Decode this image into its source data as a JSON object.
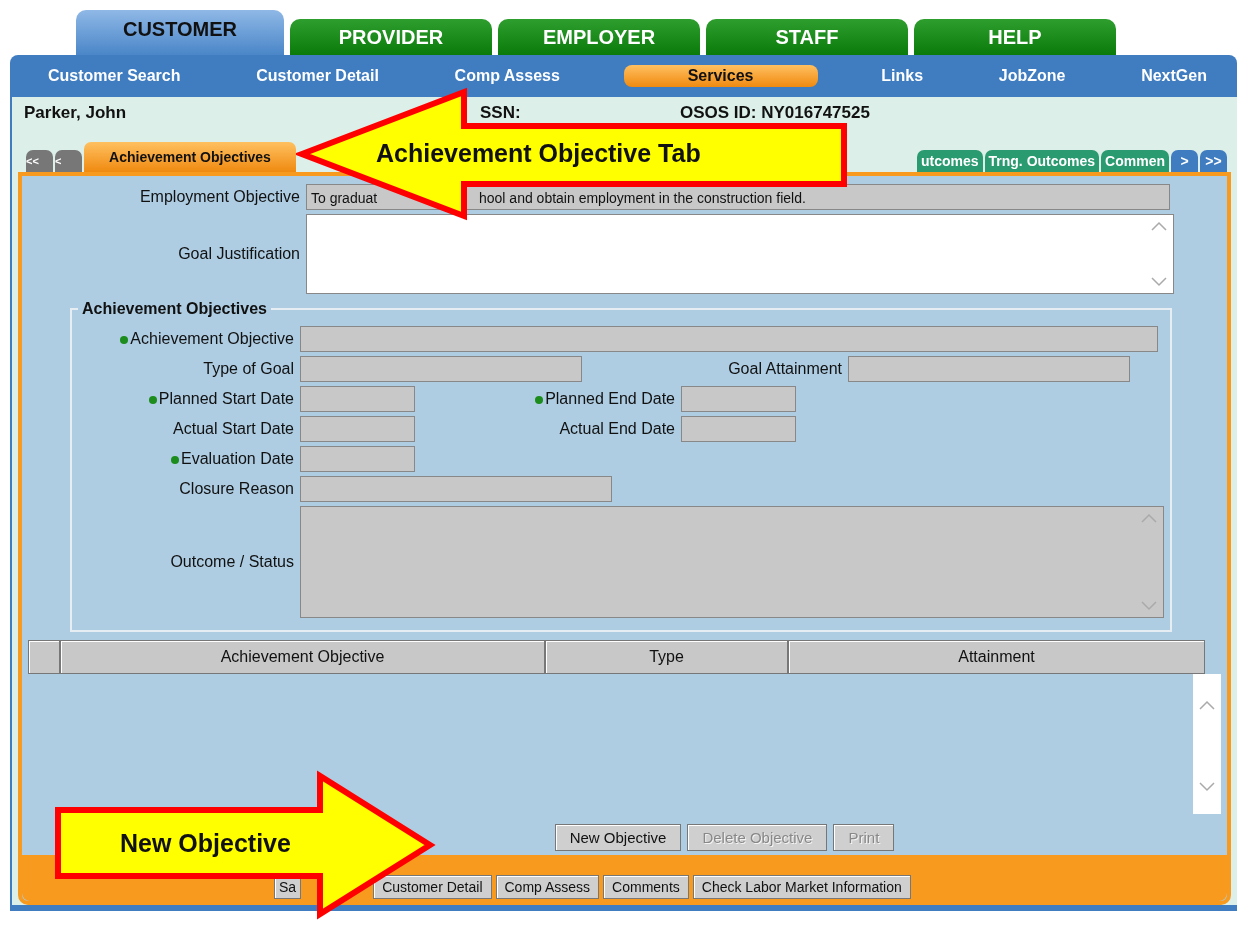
{
  "top_tabs": [
    {
      "label": "CUSTOMER",
      "selected": true
    },
    {
      "label": "PROVIDER",
      "selected": false
    },
    {
      "label": "EMPLOYER",
      "selected": false
    },
    {
      "label": "STAFF",
      "selected": false
    },
    {
      "label": "HELP",
      "selected": false
    }
  ],
  "nav_links": [
    {
      "label": "Customer Search",
      "selected": false
    },
    {
      "label": "Customer Detail",
      "selected": false
    },
    {
      "label": "Comp Assess",
      "selected": false
    },
    {
      "label": "Services",
      "selected": true
    },
    {
      "label": "Links",
      "selected": false
    },
    {
      "label": "JobZone",
      "selected": false
    },
    {
      "label": "NextGen",
      "selected": false
    }
  ],
  "customer": {
    "name": "Parker, John",
    "ssn_label": "SSN:",
    "osos_id": "OSOS ID: NY016747525"
  },
  "subtabs": [
    {
      "label": "<<",
      "kind": "nav",
      "selected": false
    },
    {
      "label": "<",
      "kind": "nav",
      "selected": false
    },
    {
      "label": "Achievement Objectives",
      "kind": "tab",
      "selected": true
    },
    {
      "label": "utcomes",
      "kind": "tab",
      "selected": false
    },
    {
      "label": "Trng. Outcomes",
      "kind": "tab",
      "selected": false
    },
    {
      "label": "Commen",
      "kind": "tab",
      "selected": false
    },
    {
      "label": ">",
      "kind": "next",
      "selected": false
    },
    {
      "label": ">>",
      "kind": "next",
      "selected": false
    }
  ],
  "employment_objective": {
    "label": "Employment Objective",
    "value_start": "To graduat",
    "value_end": "hool and obtain employment in the construction field."
  },
  "goal_justification": {
    "label": "Goal Justification"
  },
  "objectives_group": {
    "title": "Achievement Objectives",
    "rows": [
      {
        "fields": [
          {
            "label": "Achievement Objective",
            "required": true,
            "kind": "wide"
          }
        ]
      },
      {
        "fields": [
          {
            "label": "Type of Goal",
            "required": false,
            "kind": "text"
          },
          {
            "label": "Goal Attainment",
            "required": false,
            "kind": "text"
          }
        ]
      },
      {
        "fields": [
          {
            "label": "Planned Start Date",
            "required": true,
            "kind": "date"
          },
          {
            "label": "Planned End Date",
            "required": true,
            "kind": "date"
          }
        ]
      },
      {
        "fields": [
          {
            "label": "Actual Start Date",
            "required": false,
            "kind": "date"
          },
          {
            "label": "Actual End Date",
            "required": false,
            "kind": "date"
          }
        ]
      },
      {
        "fields": [
          {
            "label": "Evaluation Date",
            "required": true,
            "kind": "date"
          }
        ]
      },
      {
        "fields": [
          {
            "label": "Closure Reason",
            "required": false,
            "kind": "long"
          }
        ]
      },
      {
        "fields": [
          {
            "label": "Outcome / Status",
            "required": false,
            "kind": "area"
          }
        ]
      }
    ]
  },
  "table": {
    "columns": [
      "Achievement Objective",
      "Type",
      "Attainment"
    ]
  },
  "action_buttons": [
    {
      "label": "New Objective",
      "disabled": false
    },
    {
      "label": "Delete Objective",
      "disabled": true
    },
    {
      "label": "Print",
      "disabled": true
    }
  ],
  "footer_buttons": [
    "Sa",
    "Customer Detail",
    "Comp Assess",
    "Comments",
    "Check Labor Market Information"
  ],
  "callouts": [
    {
      "text": "Achievement Objective Tab",
      "kind": "left"
    },
    {
      "text": "New Objective",
      "kind": "right"
    }
  ]
}
